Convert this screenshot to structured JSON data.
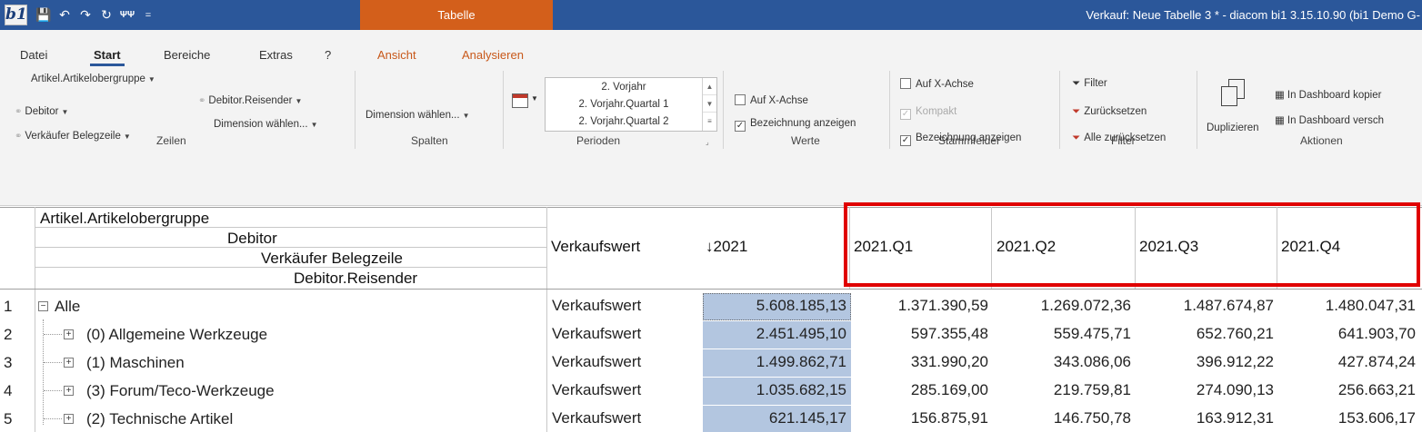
{
  "app": {
    "logo_text": "b1",
    "context_tab": "Tabelle",
    "window_title": "Verkauf: Neue Tabelle 3 * - diacom bi1 3.15.10.90 (bi1 Demo G-"
  },
  "qat": {
    "save_glyph": "💾",
    "undo_glyph": "↶",
    "redo_glyph": "↷",
    "refresh_glyph": "↻",
    "tools_glyph": "ΨΨ",
    "more_glyph": "="
  },
  "menu": {
    "items": [
      "Datei",
      "Start",
      "Bereiche",
      "Extras",
      "?",
      "Ansicht",
      "Analysieren"
    ]
  },
  "ribbon": {
    "zeilen": {
      "item1": "Artikel.Artikelobergruppe",
      "item2": "Debitor",
      "item3": "Verkäufer Belegzeile",
      "item4": "Debitor.Reisender",
      "item5": "Dimension wählen...",
      "label": "Zeilen"
    },
    "spalten": {
      "dimension": "Dimension wählen...",
      "label": "Spalten"
    },
    "perioden": {
      "values": [
        "2. Vorjahr",
        "2. Vorjahr.Quartal 1",
        "2. Vorjahr.Quartal 2"
      ],
      "label": "Perioden"
    },
    "werte": {
      "auf_x": "Auf X-Achse",
      "bezeichnung": "Bezeichnung anzeigen",
      "label": "Werte"
    },
    "stammfelder": {
      "auf_x": "Auf X-Achse",
      "kompakt": "Kompakt",
      "bezeichnung": "Bezeichnung anzeigen",
      "label": "Stammfelder"
    },
    "filter": {
      "filter": "Filter",
      "reset": "Zurücksetzen",
      "reset_all": "Alle zurücksetzen",
      "label": "Filter"
    },
    "aktionen": {
      "duplicate": "Duplizieren",
      "copy_dashboard": "In Dashboard kopier",
      "move_dashboard": "In Dashboard versch",
      "label": "Aktionen"
    }
  },
  "grid": {
    "header_dims": [
      "Artikel.Artikelobergruppe",
      "Debitor",
      "Verkäufer Belegzeile",
      "Debitor.Reisender"
    ],
    "header_measure": "Verkaufswert",
    "header_year": "↓2021",
    "header_quarters": [
      "2021.Q1",
      "2021.Q2",
      "2021.Q3",
      "2021.Q4"
    ],
    "rows": [
      {
        "num": "1",
        "label": "Alle",
        "expander": "−",
        "measure": "Verkaufswert",
        "year": "5.608.185,13",
        "q": [
          "1.371.390,59",
          "1.269.072,36",
          "1.487.674,87",
          "1.480.047,31"
        ]
      },
      {
        "num": "2",
        "label": "(0) Allgemeine Werkzeuge",
        "expander": "+",
        "measure": "Verkaufswert",
        "year": "2.451.495,10",
        "q": [
          "597.355,48",
          "559.475,71",
          "652.760,21",
          "641.903,70"
        ]
      },
      {
        "num": "3",
        "label": "(1) Maschinen",
        "expander": "+",
        "measure": "Verkaufswert",
        "year": "1.499.862,71",
        "q": [
          "331.990,20",
          "343.086,06",
          "396.912,22",
          "427.874,24"
        ]
      },
      {
        "num": "4",
        "label": "(3) Forum/Teco-Werkzeuge",
        "expander": "+",
        "measure": "Verkaufswert",
        "year": "1.035.682,15",
        "q": [
          "285.169,00",
          "219.759,81",
          "274.090,13",
          "256.663,21"
        ]
      },
      {
        "num": "5",
        "label": "(2) Technische Artikel",
        "expander": "+",
        "measure": "Verkaufswert",
        "year": "621.145,17",
        "q": [
          "156.875,91",
          "146.750,78",
          "163.912,31",
          "153.606,17"
        ]
      }
    ]
  },
  "colors": {
    "titlebar": "#2b579a",
    "context_tab": "#d35f1b",
    "selection": "#b3c6e0",
    "highlight_frame": "#e00000"
  }
}
